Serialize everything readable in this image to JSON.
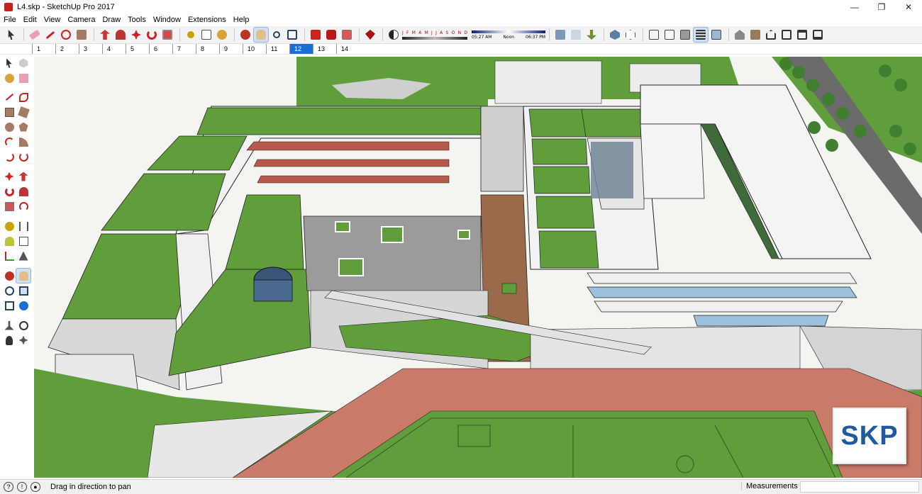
{
  "window": {
    "title": "L4.skp - SketchUp Pro 2017",
    "controls": [
      "—",
      "❐",
      "✕"
    ]
  },
  "menu": [
    "File",
    "Edit",
    "View",
    "Camera",
    "Draw",
    "Tools",
    "Window",
    "Extensions",
    "Help"
  ],
  "shadow_settings": {
    "months": [
      "J",
      "F",
      "M",
      "A",
      "M",
      "J",
      "J",
      "A",
      "S",
      "O",
      "N",
      "D"
    ],
    "time_start": "05:27 AM",
    "time_mid": "Noon",
    "time_end": "06:37 PM"
  },
  "scenes": {
    "tabs": [
      "1",
      "2",
      "3",
      "4",
      "5",
      "6",
      "7",
      "8",
      "9",
      "10",
      "11",
      "12",
      "13",
      "14"
    ],
    "active": "12"
  },
  "toolbar_icons": [
    "select-icon",
    "eraser-icon",
    "pencil-icon",
    "shapes-icon",
    "paint-bucket-icon",
    "push-pull-icon",
    "follow-me-icon",
    "move-icon",
    "rotate-icon",
    "offset-icon",
    "tape-measure-icon",
    "text-icon",
    "paint-icon",
    "orbit-icon",
    "pan-icon",
    "zoom-icon",
    "zoom-extents-icon",
    "3d-warehouse-icon",
    "extension-warehouse-icon",
    "layout-icon",
    "ruby-icon"
  ],
  "style_icons": [
    "xray-icon",
    "back-edges-icon",
    "wireframe-icon",
    "hidden-line-icon",
    "shaded-icon",
    "shaded-textures-icon",
    "monochrome-icon"
  ],
  "view_icons": [
    "iso-view-icon",
    "top-view-icon",
    "front-view-icon",
    "right-view-icon",
    "back-view-icon",
    "left-view-icon"
  ],
  "left_tools": [
    [
      "select-icon",
      "component-icon"
    ],
    [
      "paint-bucket-icon",
      "eraser-icon"
    ],
    [
      "line-icon",
      "freehand-icon"
    ],
    [
      "rectangle-icon",
      "rotated-rectangle-icon"
    ],
    [
      "circle-icon",
      "polygon-icon"
    ],
    [
      "arc-icon",
      "pie-icon"
    ],
    [
      "arc-3pt-icon",
      "arc-2pt-icon"
    ],
    [
      "move-icon",
      "push-pull-icon"
    ],
    [
      "rotate-icon",
      "follow-me-icon"
    ],
    [
      "scale-icon",
      "offset-icon"
    ],
    [
      "tape-measure-icon",
      "dimension-icon"
    ],
    [
      "protractor-icon",
      "text-icon"
    ],
    [
      "axes-icon",
      "3d-text-icon"
    ],
    [
      "orbit-icon",
      "pan-icon"
    ],
    [
      "zoom-icon",
      "zoom-window-icon"
    ],
    [
      "zoom-extents-icon",
      "previous-view-icon"
    ],
    [
      "position-camera-icon",
      "look-around-icon"
    ],
    [
      "walk-icon",
      "section-plane-icon"
    ]
  ],
  "status": {
    "message": "Drag in direction to pan",
    "measurements_label": "Measurements",
    "measurements_value": ""
  },
  "watermark": "SKP",
  "colors": {
    "scene_active": "#1a6fd6",
    "skp_blue": "#1e5aa0",
    "grass": "#5f9e3a",
    "track": "#c97a68"
  }
}
